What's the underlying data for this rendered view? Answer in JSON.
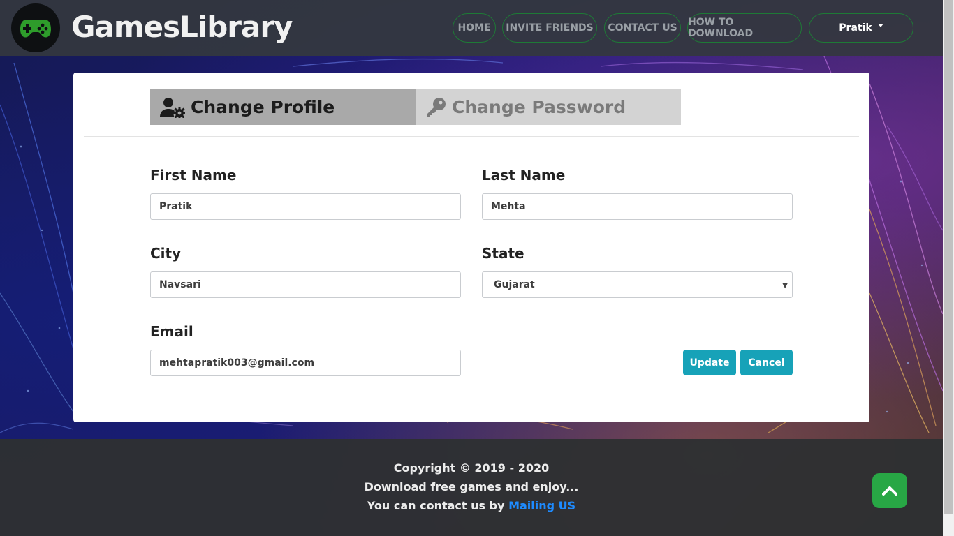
{
  "navbar": {
    "brand": "GamesLibrary",
    "links": [
      "HOME",
      "INVITE FRIENDS",
      "CONTACT US",
      "HOW TO DOWNLOAD"
    ],
    "user": "Pratik",
    "logo_icon": "gamepad-icon"
  },
  "tabs": {
    "profile": {
      "label": "Change Profile",
      "icon": "user-cog-icon"
    },
    "password": {
      "label": "Change Password",
      "icon": "key-icon"
    }
  },
  "form": {
    "first_name": {
      "label": "First Name",
      "value": "Pratik"
    },
    "last_name": {
      "label": "Last Name",
      "value": "Mehta"
    },
    "city": {
      "label": "City",
      "value": "Navsari"
    },
    "state": {
      "label": "State",
      "value": "Gujarat"
    },
    "email": {
      "label": "Email",
      "value": "mehtapratik003@gmail.com"
    },
    "update_label": "Update",
    "cancel_label": "Cancel"
  },
  "footer": {
    "copyright": "Copyright © 2019 - 2020",
    "tagline": "Download free games and enjoy...",
    "contact_prefix": "You can contact us by",
    "contact_link": "Mailing US"
  },
  "colors": {
    "accent_button": "#17a2b8",
    "nav_border": "#1e7a36",
    "top_button": "#28a745",
    "logo_green": "#2e9c2b"
  }
}
